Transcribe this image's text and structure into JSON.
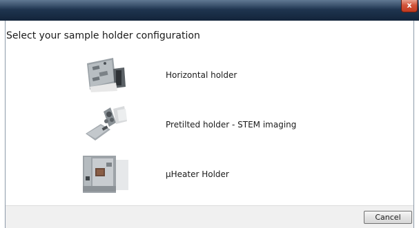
{
  "window": {
    "close_glyph": "x"
  },
  "dialog": {
    "title": "Select your sample holder configuration",
    "options": [
      {
        "label": "Horizontal holder",
        "icon": "horizontal-holder-image"
      },
      {
        "label": "Pretilted holder - STEM imaging",
        "icon": "pretilted-holder-image"
      },
      {
        "label": "µHeater Holder",
        "icon": "uheater-holder-image"
      }
    ]
  },
  "footer": {
    "cancel_label": "Cancel"
  },
  "colors": {
    "titlebar": "#1f3550",
    "close_button": "#c23a20",
    "footer_bg": "#f0f0f0"
  }
}
